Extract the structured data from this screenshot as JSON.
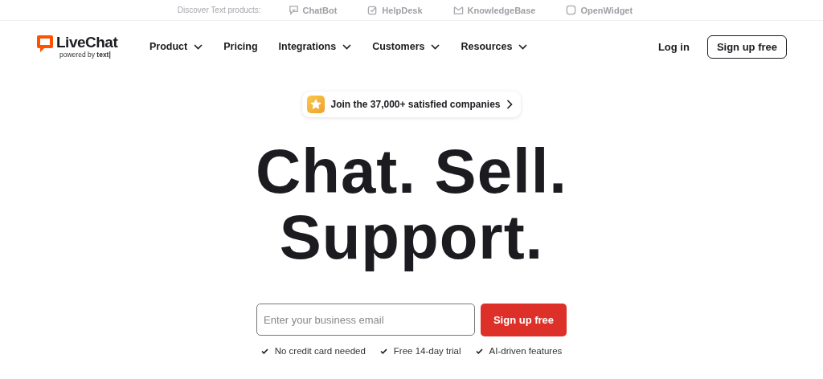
{
  "top_bar": {
    "label": "Discover Text products:",
    "products": [
      {
        "name": "ChatBot",
        "kind": "chatbot"
      },
      {
        "name": "HelpDesk",
        "kind": "helpdesk"
      },
      {
        "name": "KnowledgeBase",
        "kind": "knowledgebase"
      },
      {
        "name": "OpenWidget",
        "kind": "openwidget"
      }
    ]
  },
  "header": {
    "logo": {
      "name": "LiveChat",
      "tagline": "powered by",
      "brand": "text|"
    },
    "nav": [
      {
        "label": "Product",
        "dropdown": true
      },
      {
        "label": "Pricing",
        "dropdown": false
      },
      {
        "label": "Integrations",
        "dropdown": true
      },
      {
        "label": "Customers",
        "dropdown": true
      },
      {
        "label": "Resources",
        "dropdown": true
      }
    ],
    "login": "Log in",
    "signup": "Sign up free"
  },
  "hero": {
    "badge": "Join the 37,000+ satisfied companies",
    "headline": [
      "Chat. Sell.",
      "Support."
    ],
    "email": {
      "placeholder": "Enter your business email"
    },
    "cta": "Sign up free",
    "perks": [
      "No credit card needed",
      "Free 14-day trial",
      "AI-driven features"
    ]
  }
}
